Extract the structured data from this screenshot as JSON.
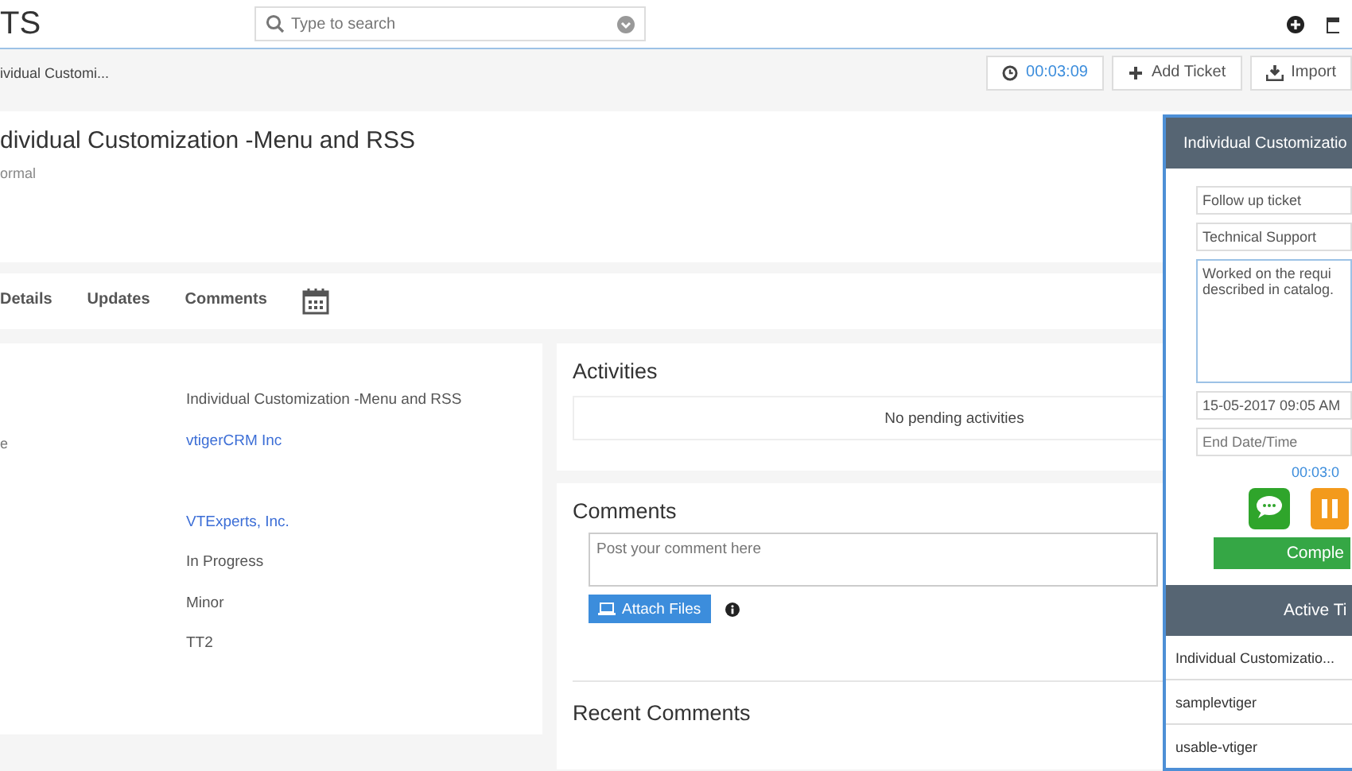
{
  "top_bar": {
    "logo": "TS",
    "search": {
      "placeholder": "Type to search"
    }
  },
  "breadcrumb": {
    "current": "ividual Customi...",
    "timer": "00:03:09",
    "buttons": [
      {
        "kind": "add",
        "label": "Add Ticket"
      },
      {
        "kind": "import",
        "label": "Import"
      }
    ]
  },
  "record": {
    "title": "dividual Customization -Menu and RSS",
    "subtitle": "ormal"
  },
  "tabs": [
    {
      "label": "Details",
      "selected": false
    },
    {
      "label": "Updates",
      "selected": false
    },
    {
      "label": "Comments",
      "selected": false
    }
  ],
  "details": [
    {
      "value": "Individual Customization -Menu and RSS",
      "kind": "text"
    },
    {
      "label": "e",
      "value": "vtigerCRM Inc",
      "kind": "link"
    },
    {
      "kind": "empty"
    },
    {
      "value": "VTExperts, Inc.",
      "kind": "link"
    },
    {
      "value": "In Progress",
      "kind": "text"
    },
    {
      "value": "Minor",
      "kind": "text"
    },
    {
      "value": "TT2",
      "kind": "text"
    }
  ],
  "activities": {
    "title": "Activities",
    "empty_text": "No pending activities"
  },
  "comments": {
    "title": "Comments",
    "placeholder": "Post your comment here",
    "attach": "Attach Files",
    "recent_title": "Recent Comments"
  },
  "timer_panel": {
    "title": "Individual Customizatio",
    "type": "Follow up ticket",
    "category": "Technical Support",
    "notes": "Worked on the requi\ndescribed in catalog.",
    "start": "15-05-2017 09:05 AM",
    "end_placeholder": "End Date/Time",
    "elapsed": "00:03:0",
    "complete": "Comple",
    "active_title": "Active Ti",
    "active_items": [
      "Individual Customizatio...",
      "samplevtiger",
      "usable-vtiger"
    ]
  }
}
